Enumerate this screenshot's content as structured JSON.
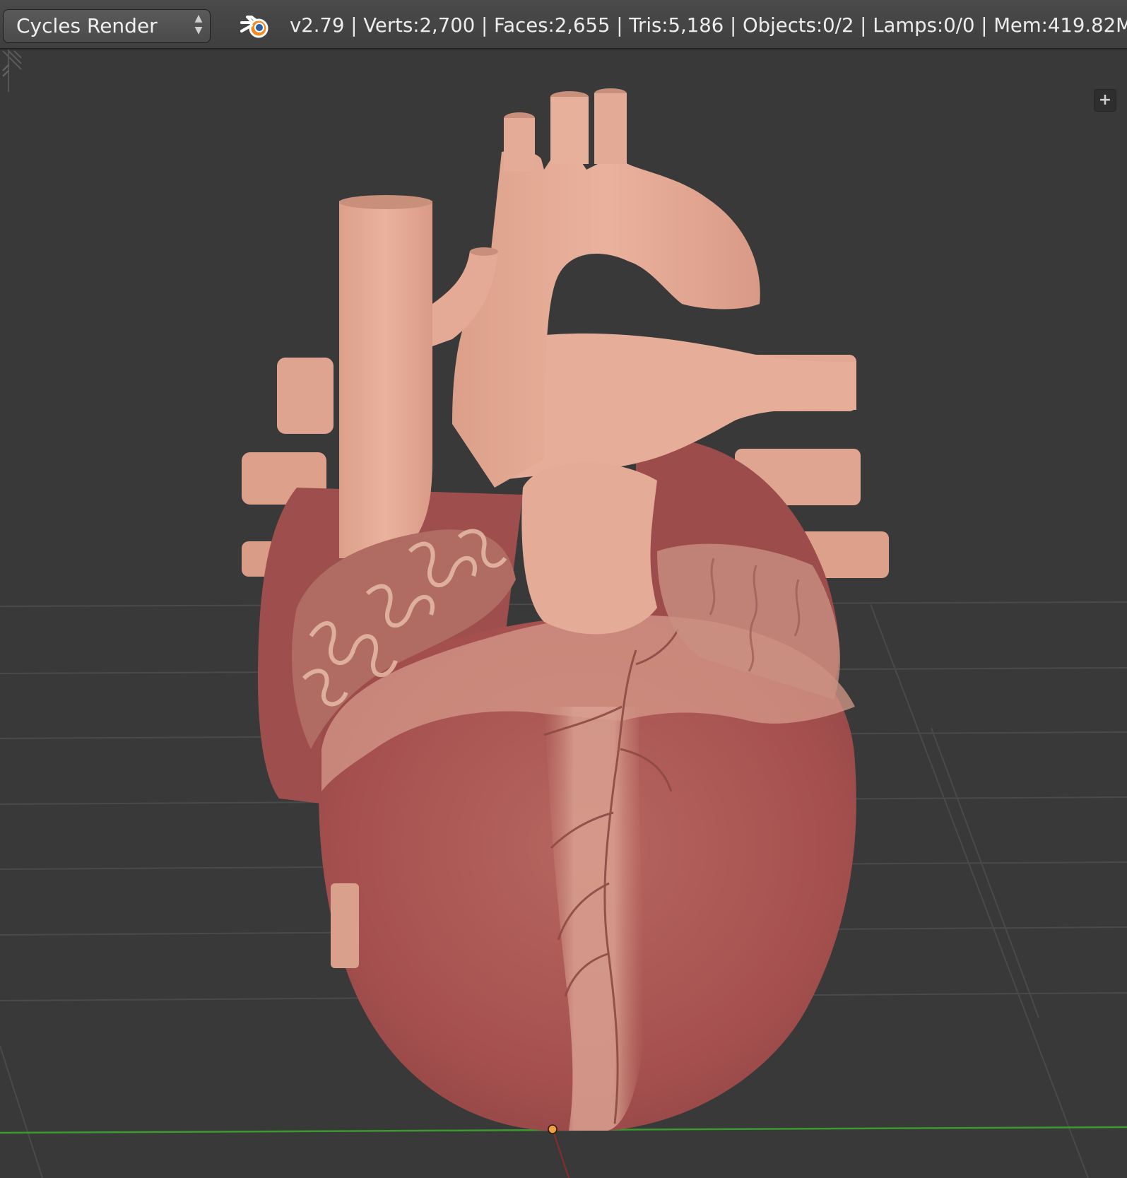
{
  "header": {
    "render_engine": "Cycles Render",
    "logo_icon": "blender-logo-icon",
    "stats": "v2.79 | Verts:2,700 | Faces:2,655 | Tris:5,186 | Objects:0/2 | Lamps:0/0 | Mem:419.82M |"
  },
  "viewport": {
    "plus_label": "+",
    "object": "heart-model",
    "colors": {
      "background": "#393939",
      "grid": "#4a4a4a",
      "x_axis": "#3a9a2e",
      "origin": "#f0a040",
      "vessel": "#e2a590",
      "myocardium": "#a5504f"
    }
  }
}
